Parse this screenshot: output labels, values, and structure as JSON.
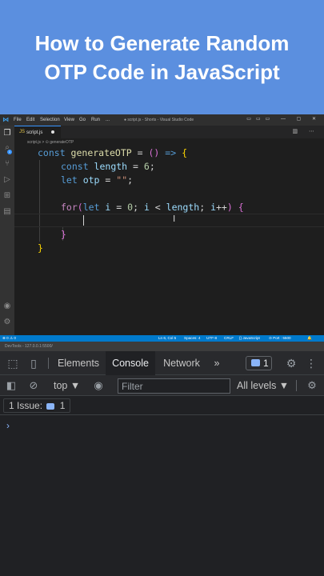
{
  "banner": {
    "title_line1": "How to Generate Random",
    "title_line2": "OTP Code in JavaScript",
    "color": "#5b8fdf"
  },
  "vscode": {
    "menu": [
      "File",
      "Edit",
      "Selection",
      "View",
      "Go",
      "Run",
      "..."
    ],
    "window_title": "● script.js - Shorts - Visual Studio Code",
    "tab": {
      "label": "script.js",
      "modified": true
    },
    "breadcrumb": "script.js > ⊙ generateOTP",
    "code": {
      "line1": {
        "kw": "const ",
        "fn": "generateOTP",
        "op": " = ",
        "br": "()",
        "arrow": " => ",
        "open": "{"
      },
      "line2": {
        "kw": "const ",
        "var": "length",
        "op": " = ",
        "num": "6",
        "end": ";"
      },
      "line3": {
        "kw": "let ",
        "var": "otp",
        "op": " = ",
        "str": "\"\"",
        "end": ";"
      },
      "line5": {
        "ctl": "for",
        "p1": "(",
        "kw": "let ",
        "v1": "i",
        "op1": " = ",
        "num": "0",
        "semi1": "; ",
        "v2": "i",
        "op2": " < ",
        "v3": "length",
        "semi2": "; ",
        "v4": "i",
        "op3": "++",
        "p2": ")",
        "sp": " ",
        "open": "{"
      },
      "line7": {
        "close": "}"
      },
      "line8": {
        "close": "}"
      }
    },
    "statusbar": {
      "left": "⊗ 0 ⚠ 0",
      "position": "Ln 6, Col 5",
      "spaces": "Spaces: 4",
      "encoding": "UTF-8",
      "eol": "CRLF",
      "language": "{} JavaScript",
      "port": "⊙ Port : 5500",
      "accent": "#007acc"
    }
  },
  "devtools": {
    "top_strip": "DevTools - 127.0.0.1:5500/",
    "tabs": [
      "Elements",
      "Console",
      "Network"
    ],
    "selected_tab": "Console",
    "more": "»",
    "issues_count": "1",
    "context": "top ▼",
    "filter_placeholder": "Filter",
    "levels": "All levels ▼",
    "issues_label": "1 Issue:",
    "issues_number": "1",
    "prompt": "›"
  },
  "icons": {
    "inspect": "inspect-icon",
    "device": "device-toggle-icon",
    "settings": "gear-icon",
    "kebab": "more-vertical-icon",
    "sidebar": "sidebar-toggle-icon",
    "clear": "clear-console-icon",
    "eye": "eye-icon"
  }
}
